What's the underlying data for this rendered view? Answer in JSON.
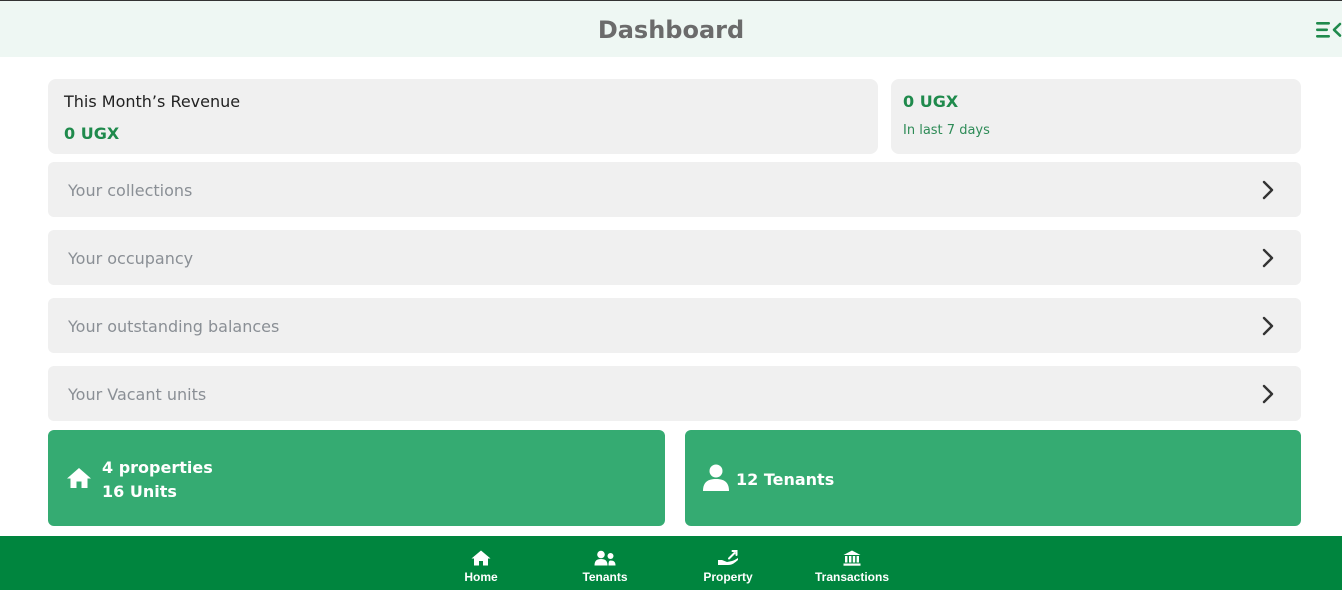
{
  "header": {
    "title": "Dashboard",
    "menu_icon": "menu-collapse-icon"
  },
  "revenue": {
    "label": "This Month’s Revenue",
    "amount": "0 UGX"
  },
  "weekly": {
    "amount": "0 UGX",
    "subtitle": "In last 7 days"
  },
  "rows": [
    {
      "label": "Your collections"
    },
    {
      "label": "Your occupancy"
    },
    {
      "label": "Your outstanding balances"
    },
    {
      "label": "Your Vacant units"
    }
  ],
  "summary": {
    "properties": "4 properties",
    "units": "16 Units",
    "tenants": "12 Tenants"
  },
  "nav": [
    {
      "label": "Home",
      "icon": "home-icon"
    },
    {
      "label": "Tenants",
      "icon": "users-icon"
    },
    {
      "label": "Property",
      "icon": "hand-key-icon"
    },
    {
      "label": "Transactions",
      "icon": "bank-icon"
    }
  ],
  "colors": {
    "accent": "#00853e",
    "card_green": "#35ab72",
    "amount_green": "#1f8a4c"
  }
}
